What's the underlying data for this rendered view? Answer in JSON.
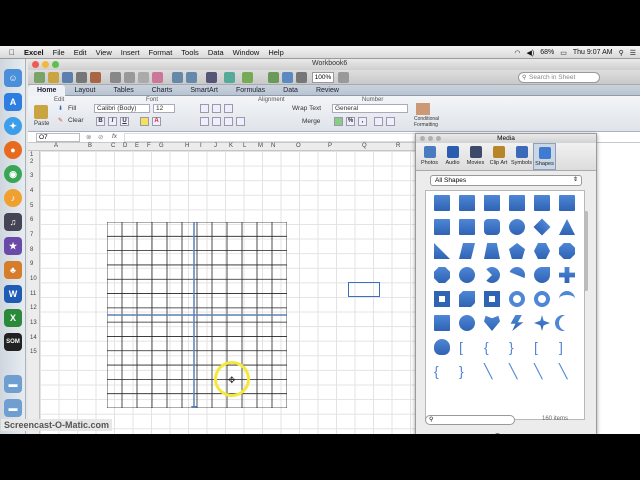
{
  "menubar": {
    "app": "Excel",
    "items": [
      "File",
      "Edit",
      "View",
      "Insert",
      "Format",
      "Tools",
      "Data",
      "Window",
      "Help"
    ],
    "battery": "68%",
    "clock": "Thu 9:07 AM"
  },
  "window": {
    "title": "Workbook6",
    "zoom": "100%",
    "search_placeholder": "Search in Sheet"
  },
  "ribbon": {
    "tabs": [
      "Home",
      "Layout",
      "Tables",
      "Charts",
      "SmartArt",
      "Formulas",
      "Data",
      "Review"
    ],
    "active_tab": "Home",
    "groups": [
      "Edit",
      "Font",
      "Alignment",
      "Number"
    ],
    "paste": "Paste",
    "fill": "Fill",
    "clear": "Clear",
    "font_name": "Calibri (Body)",
    "font_size": "12",
    "bold": "B",
    "italic": "I",
    "underline": "U",
    "wrap_text": "Wrap Text",
    "merge": "Merge",
    "number_format": "General",
    "conditional_formatting": "Conditional Formatting"
  },
  "formula_bar": {
    "cell_ref": "O7",
    "fx": "fx"
  },
  "sheet": {
    "columns": [
      "A",
      "B",
      "C",
      "D",
      "E",
      "F",
      "G",
      "H",
      "I",
      "J",
      "K",
      "L",
      "M",
      "N",
      "O",
      "P",
      "Q",
      "R"
    ],
    "rows": [
      "1",
      "2",
      "3",
      "4",
      "5",
      "6",
      "7",
      "8",
      "9",
      "10",
      "11",
      "12",
      "13",
      "14",
      "15"
    ]
  },
  "media_panel": {
    "title": "Media",
    "tabs": [
      {
        "label": "Photos",
        "icon": "photos-icon",
        "color": "#4a7bc0"
      },
      {
        "label": "Audio",
        "icon": "audio-icon",
        "color": "#2a5db0"
      },
      {
        "label": "Movies",
        "icon": "movies-icon",
        "color": "#3d4a6a"
      },
      {
        "label": "Clip Art",
        "icon": "clip-art-icon",
        "color": "#b8862a"
      },
      {
        "label": "Symbols",
        "icon": "symbols-icon",
        "color": "#3a6ab8"
      },
      {
        "label": "Shapes",
        "icon": "shapes-icon",
        "color": "#3f7bd0"
      }
    ],
    "active_tab": "Shapes",
    "category": "All Shapes",
    "search_placeholder": "",
    "count": "160 items",
    "shape_color": "#4f86d6"
  },
  "dock_icons": [
    "finder-icon",
    "app-store-icon",
    "safari-icon",
    "firefox-icon",
    "chrome-icon",
    "itunes-icon",
    "garageband-icon",
    "imovie-icon",
    "keynote-icon",
    "word-icon",
    "excel-icon",
    "screencast-icon",
    "folder-icon"
  ],
  "watermark": "Screencast-O-Matic.com"
}
